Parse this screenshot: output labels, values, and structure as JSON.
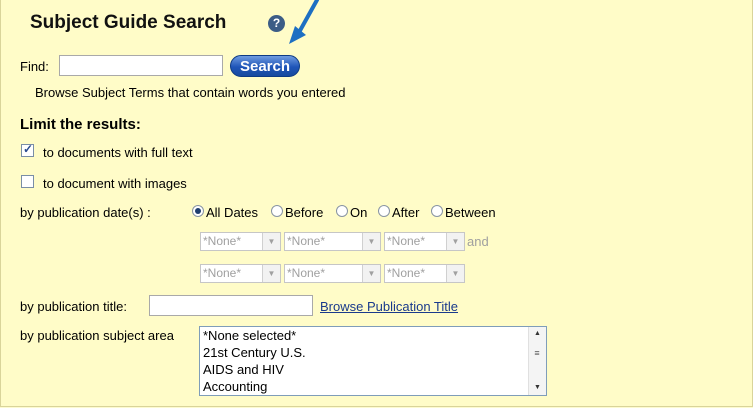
{
  "header": {
    "title": "Subject Guide Search",
    "help_icon": "question-circle-icon",
    "help_glyph": "?"
  },
  "find": {
    "label": "Find:",
    "value": "",
    "search_label": "Search",
    "browse_text": "Browse Subject Terms that contain words you entered"
  },
  "limits": {
    "heading": "Limit the results:",
    "full_text": {
      "label": "to documents with full text",
      "checked": true
    },
    "images": {
      "label": "to document with images",
      "checked": false
    }
  },
  "pub_date": {
    "label": "by publication date(s) :",
    "options": [
      "All Dates",
      "Before",
      "On",
      "After",
      "Between"
    ],
    "selected": "All Dates",
    "row1": [
      "*None*",
      "*None*",
      "*None*"
    ],
    "and_label": "and",
    "row2": [
      "*None*",
      "*None*",
      "*None*"
    ]
  },
  "pub_title": {
    "label": "by publication title:",
    "value": "",
    "browse_link": "Browse Publication Title"
  },
  "pub_subject": {
    "label": "by publication subject area",
    "options": [
      "*None selected*",
      "21st Century U.S.",
      "AIDS and HIV",
      "Accounting"
    ]
  },
  "colors": {
    "panel_bg": "#fffcc8",
    "search_button": "#1f55b8",
    "link": "#1a3a8c",
    "annotation_arrow": "#1d6fc2"
  }
}
